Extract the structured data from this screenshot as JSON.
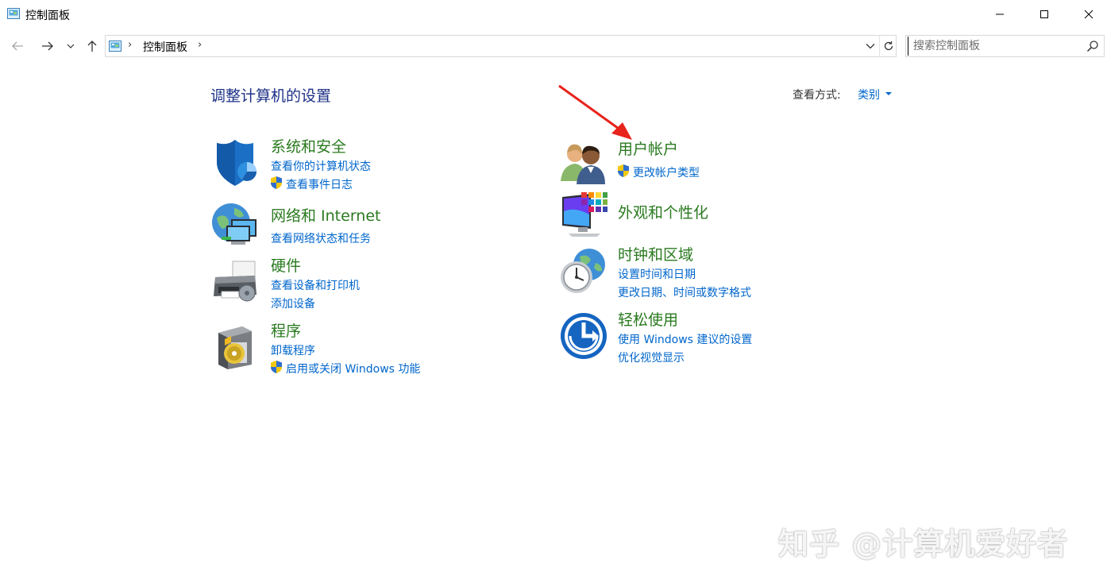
{
  "window": {
    "title": "控制面板",
    "icon": "control-panel-icon"
  },
  "address": {
    "crumbs": [
      "控制面板"
    ],
    "search_placeholder": "搜索控制面板"
  },
  "main": {
    "heading": "调整计算机的设置",
    "view_by_label": "查看方式:",
    "view_by_value": "类别"
  },
  "categories": [
    {
      "title": "系统和安全",
      "icon": "shield-security-icon",
      "links": [
        {
          "text": "查看你的计算机状态",
          "shield": false
        },
        {
          "text": "查看事件日志",
          "shield": true
        }
      ]
    },
    {
      "title": "网络和 Internet",
      "icon": "network-globe-icon",
      "links": [
        {
          "text": "查看网络状态和任务",
          "shield": false
        }
      ]
    },
    {
      "title": "硬件",
      "icon": "printer-hardware-icon",
      "links": [
        {
          "text": "查看设备和打印机",
          "shield": false
        },
        {
          "text": "添加设备",
          "shield": false
        }
      ]
    },
    {
      "title": "程序",
      "icon": "programs-disc-icon",
      "links": [
        {
          "text": "卸载程序",
          "shield": false
        },
        {
          "text": "启用或关闭 Windows 功能",
          "shield": true
        }
      ]
    },
    {
      "title": "用户帐户",
      "icon": "user-accounts-icon",
      "links": [
        {
          "text": "更改帐户类型",
          "shield": true
        }
      ]
    },
    {
      "title": "外观和个性化",
      "icon": "appearance-monitor-icon",
      "links": []
    },
    {
      "title": "时钟和区域",
      "icon": "clock-globe-icon",
      "links": [
        {
          "text": "设置时间和日期",
          "shield": false
        },
        {
          "text": "更改日期、时间或数字格式",
          "shield": false
        }
      ]
    },
    {
      "title": "轻松使用",
      "icon": "ease-of-access-icon",
      "links": [
        {
          "text": "使用 Windows 建议的设置",
          "shield": false
        },
        {
          "text": "优化视觉显示",
          "shield": false
        }
      ]
    }
  ],
  "watermark": "知乎 @计算机爱好者",
  "colors": {
    "heading": "#1e3287",
    "category_title": "#2a7a1f",
    "link": "#0066cc",
    "annotation_arrow": "#e8231b"
  }
}
